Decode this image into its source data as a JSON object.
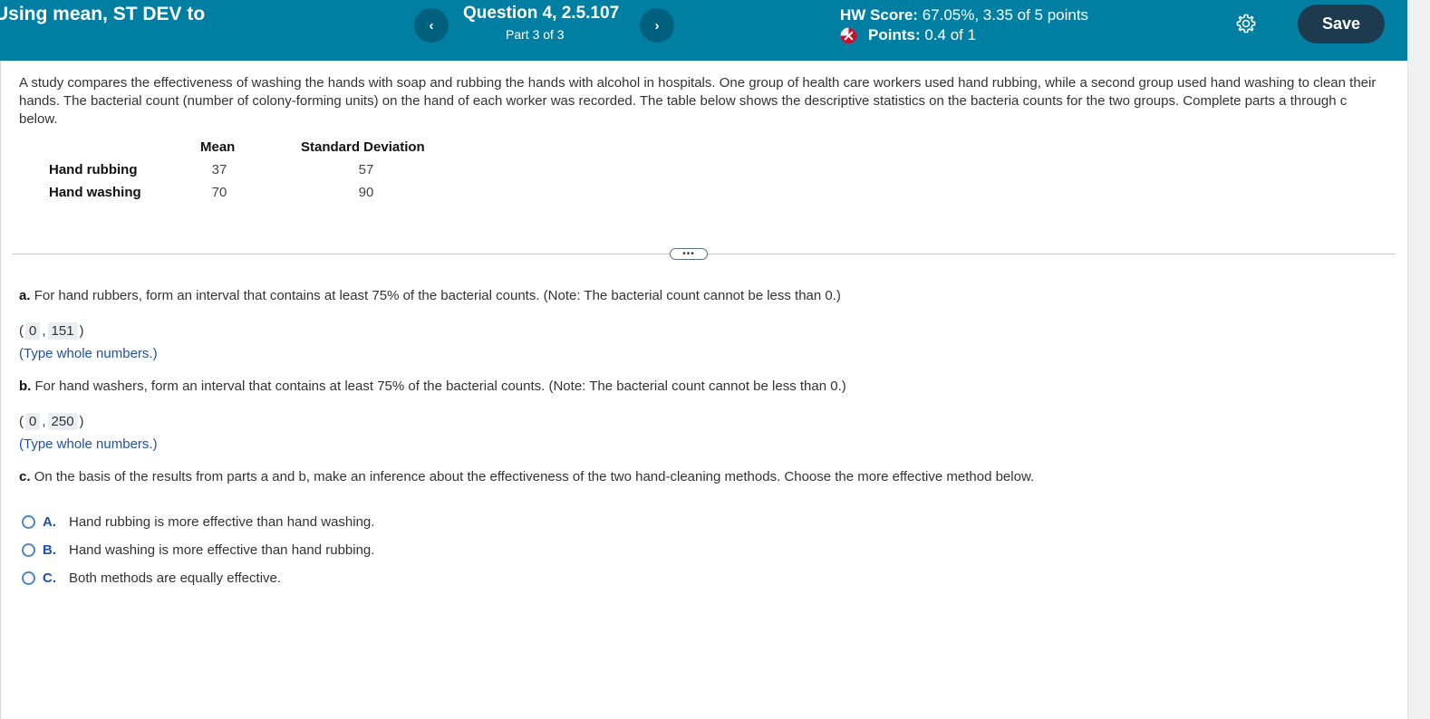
{
  "header": {
    "assignment_title": "Using mean, ST DEV to",
    "question_title": "Question 4, 2.5.107",
    "question_part": "Part 3 of 3",
    "prev_label": "‹",
    "next_label": "›",
    "hw_score_label": "HW Score:",
    "hw_score_value": "67.05%, 3.35 of 5 points",
    "points_label": "Points:",
    "points_value": "0.4 of 1",
    "save_label": "Save",
    "colors": {
      "bar": "#007fa3",
      "save": "#1d3a4e",
      "nav": "#00607d"
    }
  },
  "problem": {
    "intro": "A study compares the effectiveness of washing the hands with soap and rubbing the hands with alcohol in hospitals. One group of health care workers used hand rubbing, while a second group used hand washing to clean their hands. The bacterial count (number of colony-forming units) on the hand of each worker was recorded. The table below shows the descriptive statistics on the bacteria counts for the two groups. Complete parts a through c below.",
    "table": {
      "headers": [
        "Mean",
        "Standard Deviation"
      ],
      "rows": [
        {
          "label": "Hand rubbing",
          "mean": "37",
          "sd": "57"
        },
        {
          "label": "Hand washing",
          "mean": "70",
          "sd": "90"
        }
      ]
    }
  },
  "separator": {
    "dots_label": "•••"
  },
  "part_a": {
    "letter": "a.",
    "question": "For hand rubbers, form an interval that contains at least 75% of the bacterial counts. (Note: The bacterial count cannot be less than 0.)",
    "open": "(",
    "lower": "0",
    "comma": ",",
    "upper": "151",
    "close": ")",
    "hint": "(Type whole numbers.)"
  },
  "part_b": {
    "letter": "b.",
    "question": "For hand washers, form an interval that contains at least 75% of the bacterial counts. (Note: The bacterial count cannot be less than 0.)",
    "open": "(",
    "lower": "0",
    "comma": ",",
    "upper": "250",
    "close": ")",
    "hint": "(Type whole numbers.)"
  },
  "part_c": {
    "letter": "c.",
    "question": "On the basis of the results from parts a and b, make an inference about the effectiveness of the two hand-cleaning methods. Choose the more effective method below.",
    "options": [
      {
        "letter": "A.",
        "text": "Hand rubbing is more effective than hand washing."
      },
      {
        "letter": "B.",
        "text": "Hand washing is more effective than hand rubbing."
      },
      {
        "letter": "C.",
        "text": "Both methods are equally effective."
      }
    ]
  }
}
